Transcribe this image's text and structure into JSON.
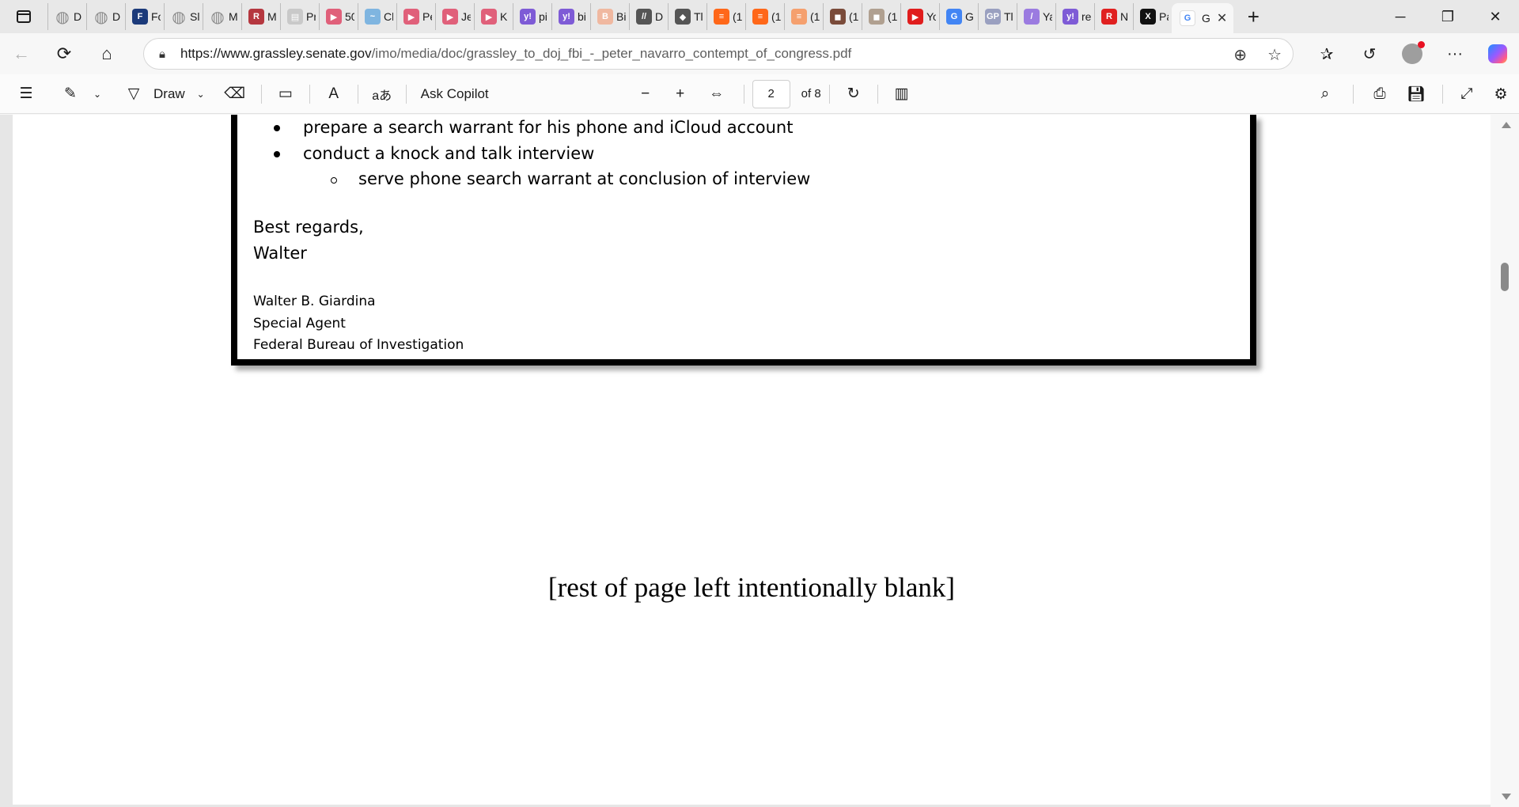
{
  "browser": {
    "tabs": [
      {
        "label": "D",
        "icon": "globe-icon",
        "color": "#8a8a8a"
      },
      {
        "label": "D",
        "icon": "globe-icon",
        "color": "#8a8a8a"
      },
      {
        "label": "Fo",
        "icon": "foxnews-icon",
        "color": "#1b3a7a"
      },
      {
        "label": "Sl",
        "icon": "globe-icon",
        "color": "#8a8a8a"
      },
      {
        "label": "M",
        "icon": "globe-icon",
        "color": "#8a8a8a"
      },
      {
        "label": "M",
        "icon": "r-logo-icon",
        "color": "#b5373f"
      },
      {
        "label": "Pr",
        "icon": "pdf-icon",
        "color": "#c9c9c9"
      },
      {
        "label": "50",
        "icon": "youtube-icon",
        "color": "#e0607a"
      },
      {
        "label": "Cl",
        "icon": "wave-icon",
        "color": "#7fb5e0"
      },
      {
        "label": "Pe",
        "icon": "youtube-icon",
        "color": "#e0607a"
      },
      {
        "label": "Je",
        "icon": "youtube-icon",
        "color": "#e0607a"
      },
      {
        "label": "K",
        "icon": "youtube-icon",
        "color": "#e0607a"
      },
      {
        "label": "pi",
        "icon": "yahoo-icon",
        "color": "#7e5bd6"
      },
      {
        "label": "bi",
        "icon": "yahoo-icon",
        "color": "#7e5bd6"
      },
      {
        "label": "Bi",
        "icon": "b-logo-icon",
        "color": "#f0b8a0"
      },
      {
        "label": "D",
        "icon": "slash-icon",
        "color": "#555555"
      },
      {
        "label": "Tl",
        "icon": "diamond-icon",
        "color": "#555555"
      },
      {
        "label": "(1",
        "icon": "substack-icon",
        "color": "#ff6719"
      },
      {
        "label": "(1",
        "icon": "substack-icon",
        "color": "#ff6719"
      },
      {
        "label": "(1",
        "icon": "substack-icon",
        "color": "#f5a06e"
      },
      {
        "label": "(1",
        "icon": "photo-icon",
        "color": "#7a4b3a"
      },
      {
        "label": "(1",
        "icon": "photo-icon",
        "color": "#b0a090"
      },
      {
        "label": "Yo",
        "icon": "youtube-icon",
        "color": "#e01d1d"
      },
      {
        "label": "G",
        "icon": "google-icon",
        "color": "#4285f4"
      },
      {
        "label": "Tl",
        "icon": "gp-icon",
        "color": "#9aa0c0"
      },
      {
        "label": "Ya",
        "icon": "feather-icon",
        "color": "#9b7be0"
      },
      {
        "label": "re",
        "icon": "yahoo-icon",
        "color": "#7e5bd6"
      },
      {
        "label": "N",
        "icon": "r-logo-icon",
        "color": "#e02020"
      },
      {
        "label": "Pa",
        "icon": "x-logo-icon",
        "color": "#111111"
      }
    ],
    "active_tab": {
      "label": "G",
      "icon": "google-icon"
    },
    "url_host": "https://www.grassley.senate.gov",
    "url_path": "/imo/media/doc/grassley_to_doj_fbi_-_peter_navarro_contempt_of_congress.pdf"
  },
  "pdf_toolbar": {
    "draw_label": "Draw",
    "copilot_label": "Ask Copilot",
    "page_number": "2",
    "page_total": "of 8"
  },
  "document": {
    "bullets": [
      "prepare a search warrant for his phone and iCloud account",
      "conduct a knock and talk interview"
    ],
    "sub_bullet": "serve phone search warrant at conclusion of interview",
    "closing": "Best regards,",
    "sender_first": "Walter",
    "signature_name": "Walter B. Giardina",
    "signature_title": "Special Agent",
    "signature_org": "Federal Bureau of Investigation",
    "blank_note": "[rest of page left intentionally blank]"
  }
}
